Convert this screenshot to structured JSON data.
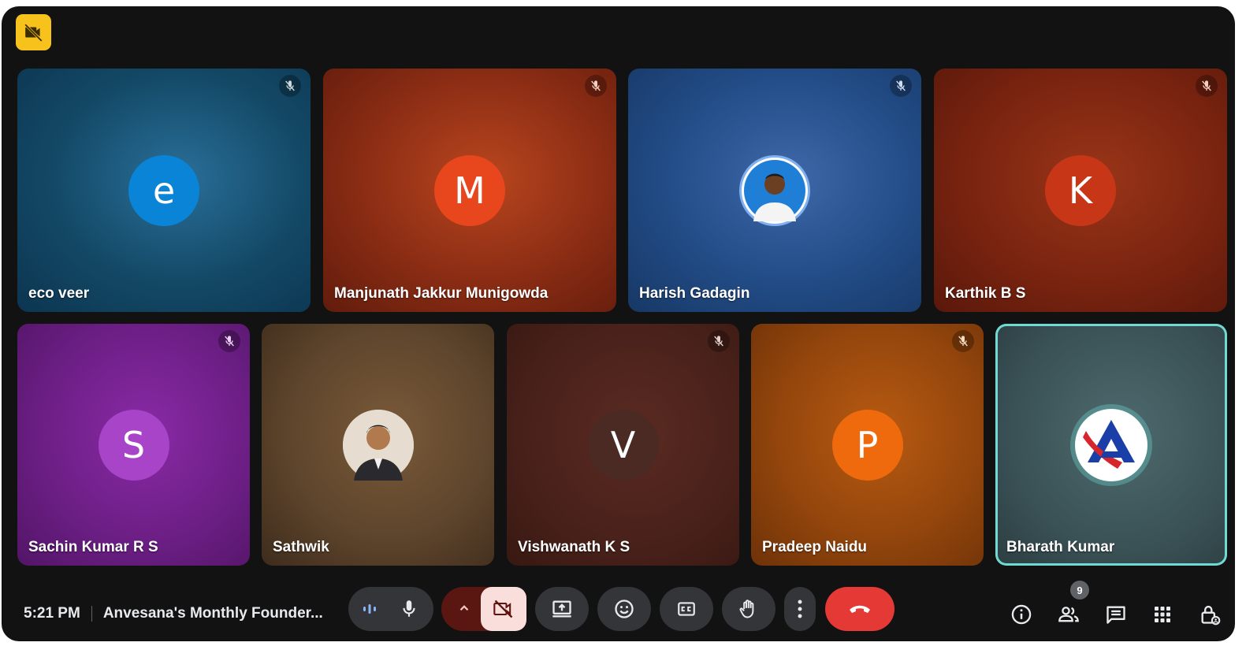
{
  "participants": [
    {
      "name": "eco veer",
      "initial": "e",
      "avatar_color": "#0a84d6",
      "muted": true
    },
    {
      "name": "Manjunath Jakkur Munigowda",
      "initial": "M",
      "avatar_color": "#e8461c",
      "muted": true
    },
    {
      "name": "Harish Gadagin",
      "initial": "",
      "avatar_color": "#2e6fc7",
      "muted": true,
      "photo": "person-photo"
    },
    {
      "name": "Karthik B S",
      "initial": "K",
      "avatar_color": "#c83618",
      "muted": true
    },
    {
      "name": "Sachin Kumar R S",
      "initial": "S",
      "avatar_color": "#a844c8",
      "muted": true
    },
    {
      "name": "Sathwik",
      "initial": "",
      "avatar_color": "#e0d6c8",
      "muted": false,
      "photo": "person-photo"
    },
    {
      "name": "Vishwanath K S",
      "initial": "V",
      "avatar_color": "#4a2a22",
      "muted": true
    },
    {
      "name": "Pradeep Naidu",
      "initial": "P",
      "avatar_color": "#ee6a0c",
      "muted": true
    },
    {
      "name": "Bharath Kumar",
      "initial": "",
      "avatar_color": "#ffffff",
      "muted": false,
      "photo": "logo-a",
      "active": true
    }
  ],
  "bottom_bar": {
    "time": "5:21 PM",
    "meeting_title": "Anvesana's Monthly Founder...",
    "participant_count": "9"
  },
  "icons": {
    "top_badge": "camera-off-icon",
    "controls": [
      "audio-level-icon",
      "microphone-icon",
      "chevron-up-icon",
      "camera-off-icon",
      "present-screen-icon",
      "emoji-icon",
      "captions-icon",
      "raise-hand-icon",
      "more-options-icon",
      "end-call-icon"
    ],
    "right": [
      "info-icon",
      "people-icon",
      "chat-icon",
      "activities-icon",
      "host-controls-icon"
    ]
  },
  "colors": {
    "end_call": "#e53935",
    "camera_toggle_bg": "#f9dedc",
    "camera_split_bg": "#5a1712",
    "active_speaker_border": "#6fdad4"
  }
}
